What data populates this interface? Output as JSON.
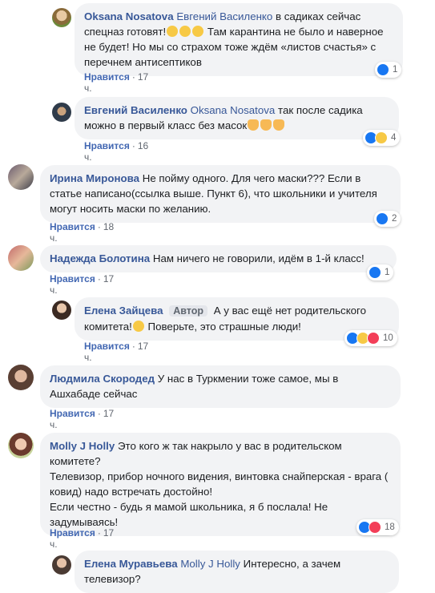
{
  "ui": {
    "like": "Нравится",
    "dot": "·"
  },
  "comments": [
    {
      "author": "Oksana Nosatova",
      "mention": "Евгений Василенко",
      "text": "в садиках сейчас спецназ готовят!",
      "text2": " Там карантина не было и наверное не будет! Но мы со страхом тоже ждём «листов счастья» с перечнем антисептиков",
      "time": "17 ч.",
      "reactions": "1"
    },
    {
      "author": "Евгений Василенко",
      "mention": "Oksana Nosatova",
      "text": "так после садика можно в первый класс без масок",
      "time": "16 ч.",
      "reactions": "4"
    },
    {
      "author": "Ирина Миронова",
      "text": "Не пойму одного. Для чего маски??? Если в статье написано(ссылка выше. Пункт 6), что школьники и учителя могут носить маски по желанию.",
      "time": "18 ч.",
      "reactions": "2"
    },
    {
      "author": "Надежда Болотина",
      "text": "Нам ничего не говорили, идём в 1-й класс!",
      "time": "17 ч.",
      "reactions": "1"
    },
    {
      "author": "Елена Зайцева",
      "badge": "Автор",
      "text": "А у вас ещё нет родительского комитета!",
      "text2": " Поверьте, это страшные люди!",
      "time": "17 ч.",
      "reactions": "10"
    },
    {
      "author": "Людмила Скородед",
      "text": "У нас в Туркмении тоже самое, мы в Ашхабаде сейчас",
      "time": "17 ч."
    },
    {
      "author": "Molly J Holly",
      "text": "Это кого ж так накрыло у вас в родительском комитете?",
      "line2": "Телевизор, прибор ночного видения, винтовка снайперская - врага ( ковид) надо встречать достойно!",
      "line3": "Если честно - будь я мамой школьника, я б послала! Не задумываясь!",
      "time": "17 ч.",
      "reactions": "18"
    },
    {
      "author": "Елена Муравьева",
      "mention": "Molly J Holly",
      "text": "Интересно, а зачем телевизор?"
    }
  ],
  "colors": {
    "link": "#385898",
    "bubble": "#f2f3f5",
    "like": "#1877f2",
    "love": "#f33e58",
    "haha": "#f7c945"
  }
}
